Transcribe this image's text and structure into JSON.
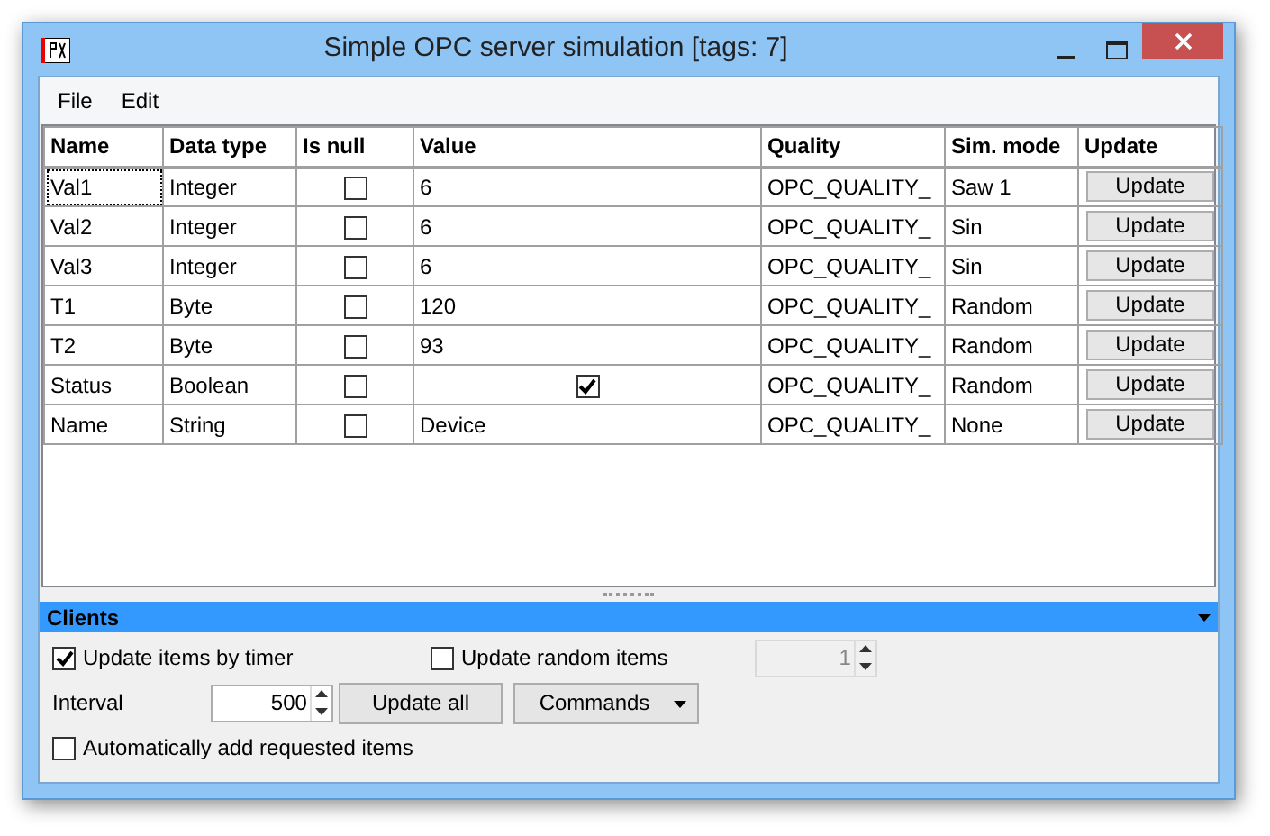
{
  "window": {
    "title": "Simple OPC server simulation [tags: 7]"
  },
  "menu": [
    "File",
    "Edit"
  ],
  "table": {
    "columns": [
      "Name",
      "Data type",
      "Is null",
      "Value",
      "Quality",
      "Sim. mode",
      "Update"
    ],
    "rows": [
      {
        "name": "Val1",
        "data_type": "Integer",
        "is_null": false,
        "value": {
          "kind": "text",
          "text": "6"
        },
        "quality": "OPC_QUALITY_",
        "sim_mode": "Saw 1",
        "button": "Update",
        "focused": true
      },
      {
        "name": "Val2",
        "data_type": "Integer",
        "is_null": false,
        "value": {
          "kind": "text",
          "text": "6"
        },
        "quality": "OPC_QUALITY_",
        "sim_mode": "Sin",
        "button": "Update",
        "focused": false
      },
      {
        "name": "Val3",
        "data_type": "Integer",
        "is_null": false,
        "value": {
          "kind": "text",
          "text": "6"
        },
        "quality": "OPC_QUALITY_",
        "sim_mode": "Sin",
        "button": "Update",
        "focused": false
      },
      {
        "name": "T1",
        "data_type": "Byte",
        "is_null": false,
        "value": {
          "kind": "text",
          "text": "120"
        },
        "quality": "OPC_QUALITY_",
        "sim_mode": "Random",
        "button": "Update",
        "focused": false
      },
      {
        "name": "T2",
        "data_type": "Byte",
        "is_null": false,
        "value": {
          "kind": "text",
          "text": "93"
        },
        "quality": "OPC_QUALITY_",
        "sim_mode": "Random",
        "button": "Update",
        "focused": false
      },
      {
        "name": "Status",
        "data_type": "Boolean",
        "is_null": false,
        "value": {
          "kind": "checkbox",
          "checked": true
        },
        "quality": "OPC_QUALITY_",
        "sim_mode": "Random",
        "button": "Update",
        "focused": false
      },
      {
        "name": "Name",
        "data_type": "String",
        "is_null": false,
        "value": {
          "kind": "text",
          "text": "Device"
        },
        "quality": "OPC_QUALITY_",
        "sim_mode": "None",
        "button": "Update",
        "focused": false
      }
    ]
  },
  "clients": {
    "title": "Clients",
    "update_by_timer": {
      "label": "Update items by timer",
      "checked": true
    },
    "update_random": {
      "label": "Update random items",
      "checked": false
    },
    "random_count": {
      "value": "1",
      "disabled": true
    },
    "interval": {
      "label": "Interval",
      "value": "500"
    },
    "update_all": "Update all",
    "commands": "Commands",
    "auto_add": {
      "label": "Automatically add requested items",
      "checked": false
    }
  }
}
